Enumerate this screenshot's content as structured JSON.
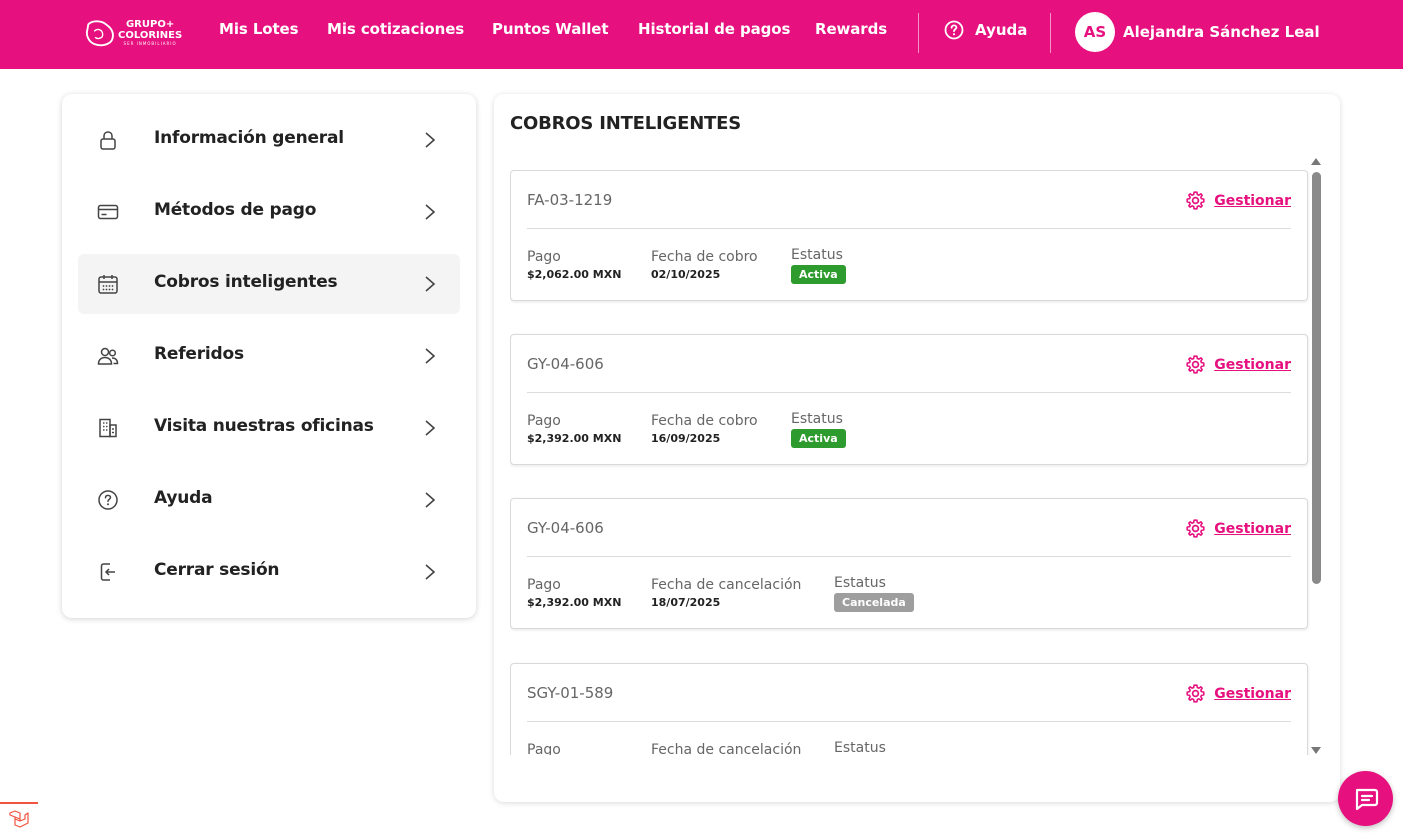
{
  "brand": {
    "line1": "GRUPO+",
    "line2": "COLORINES",
    "line3": "SER INMOBILIARIO"
  },
  "nav": {
    "items": [
      {
        "label": "Mis Lotes"
      },
      {
        "label": "Mis cotizaciones"
      },
      {
        "label": "Puntos Wallet"
      },
      {
        "label": "Historial de pagos"
      },
      {
        "label": "Rewards"
      }
    ],
    "help_label": "Ayuda",
    "user_initials": "AS",
    "user_name": "Alejandra Sánchez Leal"
  },
  "sidebar": {
    "items": [
      {
        "label": "Información general",
        "icon": "lock-icon"
      },
      {
        "label": "Métodos de pago",
        "icon": "credit-card-icon"
      },
      {
        "label": "Cobros inteligentes",
        "icon": "calendar-icon",
        "active": true
      },
      {
        "label": "Referidos",
        "icon": "users-icon"
      },
      {
        "label": "Visita nuestras oficinas",
        "icon": "building-icon"
      },
      {
        "label": "Ayuda",
        "icon": "help-circle-icon"
      },
      {
        "label": "Cerrar sesión",
        "icon": "logout-icon"
      }
    ]
  },
  "main": {
    "title": "COBROS INTELIGENTES",
    "manage_label": "Gestionar",
    "cards": [
      {
        "code": "FA-03-1219",
        "pay_label": "Pago",
        "pay_value": "$2,062.00 MXN",
        "date_label": "Fecha de cobro",
        "date_value": "02/10/2025",
        "status_label": "Estatus",
        "status": "Activa",
        "status_color": "#2e9b2e"
      },
      {
        "code": "GY-04-606",
        "pay_label": "Pago",
        "pay_value": "$2,392.00 MXN",
        "date_label": "Fecha de cobro",
        "date_value": "16/09/2025",
        "status_label": "Estatus",
        "status": "Activa",
        "status_color": "#2e9b2e"
      },
      {
        "code": "GY-04-606",
        "pay_label": "Pago",
        "pay_value": "$2,392.00 MXN",
        "date_label": "Fecha de cancelación",
        "date_value": "18/07/2025",
        "status_label": "Estatus",
        "status": "Cancelada",
        "status_color": "#9e9e9e"
      },
      {
        "code": "SGY-01-589",
        "pay_label": "Pago",
        "pay_value": "",
        "date_label": "Fecha de cancelación",
        "date_value": "",
        "status_label": "Estatus",
        "status": "",
        "status_color": "#9e9e9e"
      }
    ]
  },
  "colors": {
    "brand": "#e6107f",
    "active": "#2e9b2e",
    "cancelled": "#9e9e9e"
  }
}
